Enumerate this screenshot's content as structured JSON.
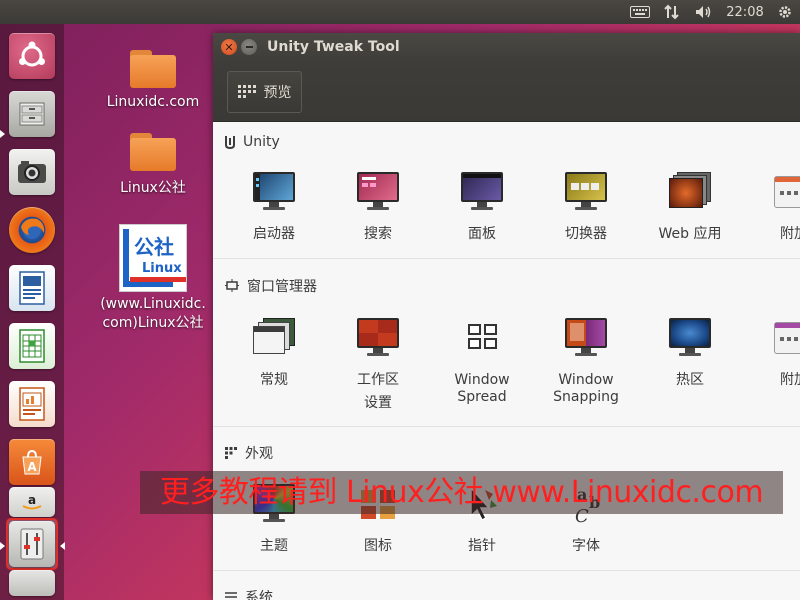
{
  "top_panel": {
    "time": "22:08",
    "icons": [
      "keyboard-icon",
      "network-icon",
      "volume-icon",
      "settings-gear-icon"
    ]
  },
  "launcher": {
    "items": [
      {
        "name": "ubuntu-dash-icon"
      },
      {
        "name": "file-manager-icon"
      },
      {
        "name": "image-viewer-icon"
      },
      {
        "name": "firefox-icon"
      },
      {
        "name": "writer-icon"
      },
      {
        "name": "calc-icon"
      },
      {
        "name": "impress-icon"
      },
      {
        "name": "software-center-icon"
      },
      {
        "name": "amazon-icon"
      },
      {
        "name": "unity-tweak-tool-icon"
      }
    ]
  },
  "desktop": {
    "icons": [
      {
        "label": "Linuxidc.com"
      },
      {
        "label": "Linux公社"
      },
      {
        "label_line1": "(www.Linuxidc.",
        "label_line2": "com)Linux公社",
        "logo_text_top": "公社",
        "logo_text_bottom": "Linux"
      }
    ]
  },
  "window": {
    "title": "Unity Tweak Tool",
    "toolbar": {
      "overview_label": "预览"
    },
    "sections": [
      {
        "title": "Unity",
        "tools": [
          {
            "label": "启动器"
          },
          {
            "label": "搜索"
          },
          {
            "label": "面板"
          },
          {
            "label": "切换器"
          },
          {
            "label": "Web 应用"
          },
          {
            "label": "附加"
          }
        ]
      },
      {
        "title": "窗口管理器",
        "tools": [
          {
            "label": "常规"
          },
          {
            "label_line1": "工作区",
            "label_line2": "设置"
          },
          {
            "label_line1": "Window",
            "label_line2": "Spread"
          },
          {
            "label_line1": "Window",
            "label_line2": "Snapping"
          },
          {
            "label": "热区"
          },
          {
            "label": "附加"
          }
        ]
      },
      {
        "title": "外观",
        "tools": [
          {
            "label": "主题"
          },
          {
            "label": "图标"
          },
          {
            "label": "指针"
          },
          {
            "label": "字体"
          }
        ]
      },
      {
        "title": "系统"
      }
    ]
  },
  "watermark": {
    "text": "更多教程请到 Linux公社 www.Linuxidc.com"
  },
  "colors": {
    "accent_red": "#ff1f1f",
    "panel_bg": "#3c3b37",
    "close_button": "#e3582b"
  }
}
